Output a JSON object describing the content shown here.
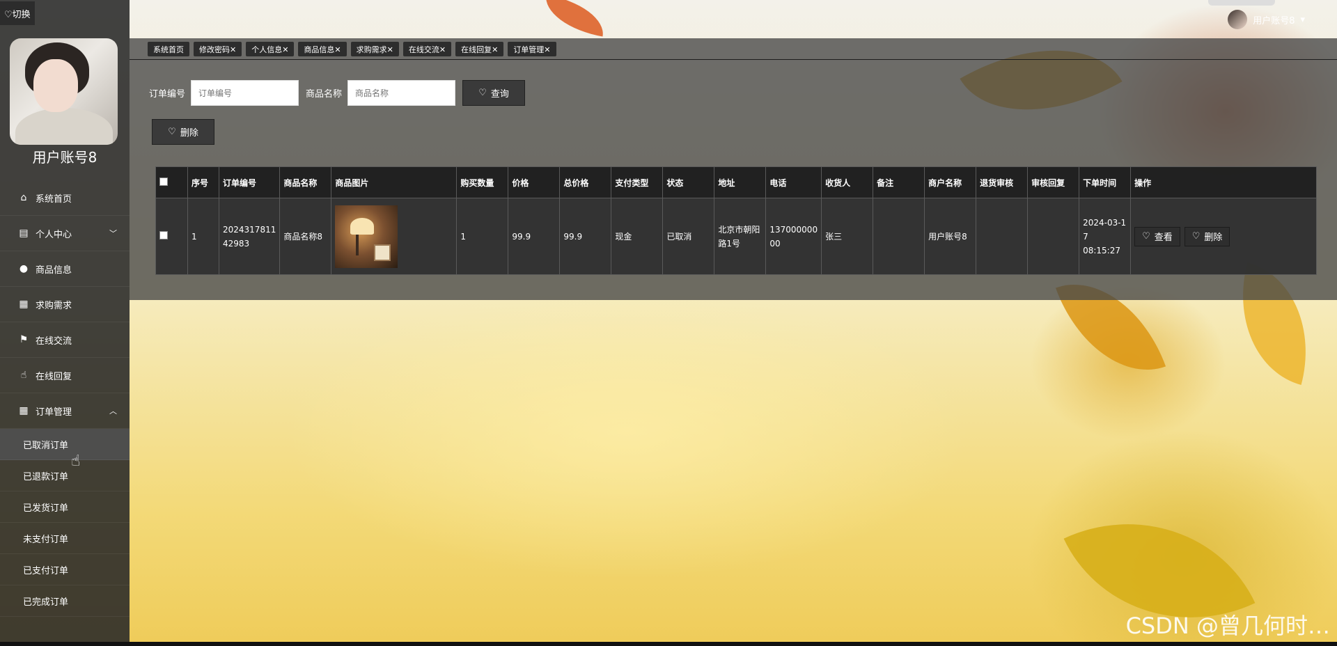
{
  "top": {
    "switch_label": "♡切换",
    "user_label": "用户账号8"
  },
  "sidebar": {
    "username": "用户账号8",
    "items": [
      {
        "label": "系统首页",
        "icon": "home-icon"
      },
      {
        "label": "个人中心",
        "icon": "card-icon"
      },
      {
        "label": "商品信息",
        "icon": "user-icon"
      },
      {
        "label": "求购需求",
        "icon": "grid-icon"
      },
      {
        "label": "在线交流",
        "icon": "flag-icon"
      },
      {
        "label": "在线回复",
        "icon": "thumb-icon"
      },
      {
        "label": "订单管理",
        "icon": "grid-icon"
      }
    ],
    "submenu": [
      {
        "label": "已取消订单"
      },
      {
        "label": "已退款订单"
      },
      {
        "label": "已发货订单"
      },
      {
        "label": "未支付订单"
      },
      {
        "label": "已支付订单"
      },
      {
        "label": "已完成订单"
      }
    ]
  },
  "tabs": [
    {
      "label": "系统首页"
    },
    {
      "label": "修改密码✕"
    },
    {
      "label": "个人信息✕"
    },
    {
      "label": "商品信息✕"
    },
    {
      "label": "求购需求✕"
    },
    {
      "label": "在线交流✕"
    },
    {
      "label": "在线回复✕"
    },
    {
      "label": "订单管理✕"
    }
  ],
  "search": {
    "order_no_label": "订单编号",
    "order_no_placeholder": "订单编号",
    "goods_name_label": "商品名称",
    "goods_name_placeholder": "商品名称",
    "query_label": "查询",
    "delete_label": "删除"
  },
  "table": {
    "headers": [
      "序号",
      "订单编号",
      "商品名称",
      "商品图片",
      "购买数量",
      "价格",
      "总价格",
      "支付类型",
      "状态",
      "地址",
      "电话",
      "收货人",
      "备注",
      "商户名称",
      "退货审核",
      "审核回复",
      "下单时间",
      "操作"
    ],
    "rows": [
      {
        "index": "1",
        "order_no": "2024317811 42983",
        "goods_name": "商品名称8",
        "quantity": "1",
        "price": "99.9",
        "total": "99.9",
        "pay_type": "现金",
        "status": "已取消",
        "address": "北京市朝阳路1号",
        "phone": "137000000 00",
        "receiver": "张三",
        "remark": "",
        "merchant": "用户账号8",
        "return_review": "",
        "review_reply": "",
        "order_time": "2024-03-1 7 08:15:27",
        "view_label": "查看",
        "delete_label": "删除"
      }
    ]
  },
  "watermark": "CSDN @曾几何时…"
}
